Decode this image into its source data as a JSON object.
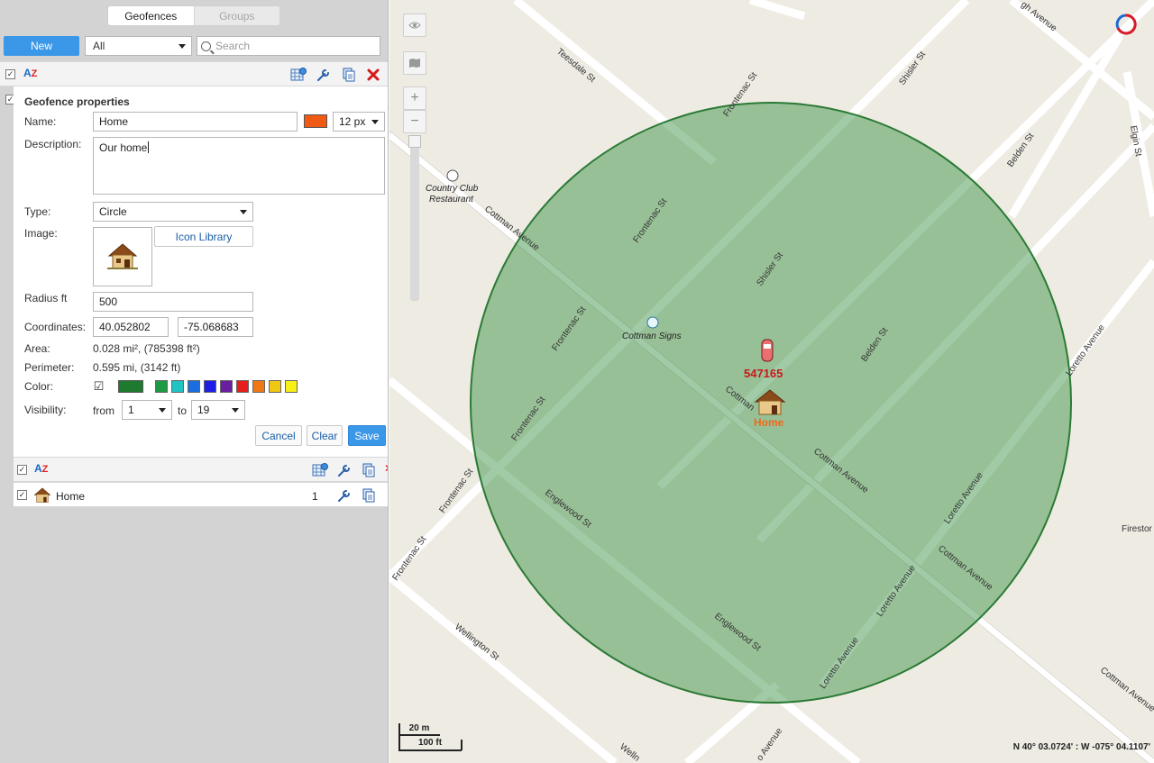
{
  "tabs": {
    "geofences": "Geofences",
    "groups": "Groups"
  },
  "toolbar": {
    "new_label": "New",
    "filter_value": "All",
    "search_placeholder": "Search"
  },
  "list_header": {
    "sort_label": "A",
    "sort_sub": "Z"
  },
  "form": {
    "title": "Geofence properties",
    "name_label": "Name:",
    "name_value": "Home",
    "line_width": "12 px",
    "description_label": "Description:",
    "description_value": "Our home",
    "type_label": "Type:",
    "type_value": "Circle",
    "image_label": "Image:",
    "icon_library_label": "Icon Library",
    "radius_label": "Radius ft",
    "radius_value": "500",
    "coordinates_label": "Coordinates:",
    "lat_value": "40.052802",
    "lon_value": "-75.068683",
    "area_label": "Area:",
    "area_value": "0.028 mi², (785398 ft²)",
    "perimeter_label": "Perimeter:",
    "perimeter_value": "0.595 mi, (3142 ft)",
    "color_label": "Color:",
    "visibility_label": "Visibility:",
    "from_label": "from",
    "from_value": "1",
    "to_label": "to",
    "to_value": "19",
    "cancel_label": "Cancel",
    "clear_label": "Clear",
    "save_label": "Save",
    "selected_color": "#f05a14",
    "current_color": "#1e7a2e",
    "palette": [
      "#1e9a44",
      "#1ec4c4",
      "#1a6ee0",
      "#1e1ee6",
      "#6a1ea0",
      "#e61e1e",
      "#f07814",
      "#f0c814",
      "#f8f014"
    ]
  },
  "list": [
    {
      "name": "Home",
      "count": "1"
    }
  ],
  "map": {
    "streets": {
      "teesdale": "Teesdale St",
      "frontenac1": "Frontenac St",
      "frontenac2": "Frontenac St",
      "frontenac3": "Frontenac St",
      "frontenac4": "Frontenac St",
      "frontenac5": "Frontenac St",
      "frontenac6": "Frontenac St",
      "shisler1": "Shisler St",
      "shisler2": "Shisler St",
      "belden1": "Belden St",
      "belden2": "Belden St",
      "elgin": "Elgin St",
      "cottman1": "Cottman Avenue",
      "cottman2": "Cottman",
      "cottman3": "Cottman Avenue",
      "cottman4": "Cottman Avenue",
      "cottman5": "Cottman Avenue",
      "englewood1": "Englewood St",
      "englewood2": "Englewood St",
      "loretto1": "Loretto Avenue",
      "loretto2": "Loretto Avenue",
      "loretto3": "Loretto Avenue",
      "loretto4": "Loretto Avenue",
      "wellington": "Wellington St",
      "wellington2": "Welln",
      "avenue_top": "gh Avenue",
      "avenue_bottom": "o Avenue",
      "firestone": "Firestor"
    },
    "poi_country_club_1": "Country Club",
    "poi_country_club_2": "Restaurant",
    "poi_cottman_signs": "Cottman Signs",
    "vehicle_label": "547165",
    "geofence_label": "Home",
    "scale_metric": "20 m",
    "scale_imperial": "100 ft",
    "coordinates": "N 40° 03.0724' : W -075° 04.1107'",
    "geofence_fill": "#2e8b3a",
    "geofence_stroke": "#2a7a34"
  }
}
